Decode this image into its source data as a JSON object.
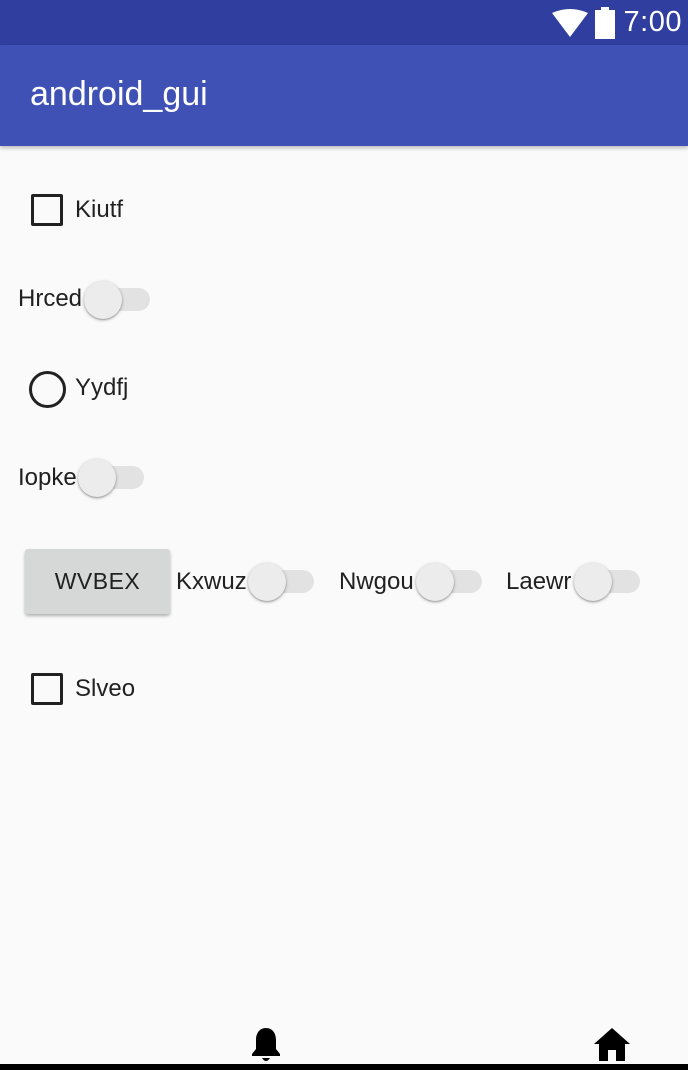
{
  "status_bar": {
    "time": "7:00",
    "icons": [
      "wifi-icon",
      "battery-icon"
    ],
    "color": "#303f9f"
  },
  "app_bar": {
    "title": "android_gui",
    "color": "#3f51b5"
  },
  "widgets": {
    "checkbox_1": {
      "label": "Kiutf",
      "checked": false
    },
    "switch_1": {
      "label": "Hrced",
      "on": false
    },
    "radio_1": {
      "label": "Yydfj",
      "selected": false
    },
    "switch_2": {
      "label": "Iopke",
      "on": false
    },
    "button_1": {
      "label": "WVBEX"
    },
    "switch_3": {
      "label": "Kxwuz",
      "on": false
    },
    "switch_4": {
      "label": "Nwgou",
      "on": false
    },
    "switch_5": {
      "label": "Laewr",
      "on": false
    },
    "checkbox_2": {
      "label": "Slveo",
      "checked": false
    }
  },
  "bottom_nav": {
    "icons": [
      "notification-bell-icon",
      "home-icon"
    ]
  }
}
